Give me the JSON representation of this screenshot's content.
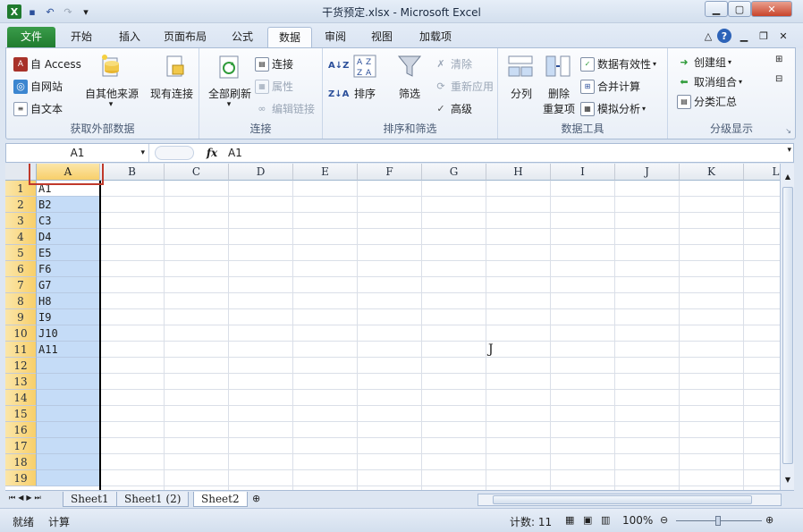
{
  "window": {
    "title": "干货预定.xlsx - Microsoft Excel",
    "minimize_icon": "minimize-icon",
    "maximize_icon": "restore-icon",
    "close_icon": "close-icon"
  },
  "tabs": [
    {
      "label": "文件"
    },
    {
      "label": "开始"
    },
    {
      "label": "插入"
    },
    {
      "label": "页面布局"
    },
    {
      "label": "公式"
    },
    {
      "label": "数据"
    },
    {
      "label": "审阅"
    },
    {
      "label": "视图"
    },
    {
      "label": "加载项"
    }
  ],
  "ribbon": {
    "external": {
      "access": "自 Access",
      "web": "自网站",
      "text": "自文本",
      "other": "自其他来源",
      "existing": "现有连接",
      "label": "获取外部数据"
    },
    "connections": {
      "refresh_all": "全部刷新",
      "connections": "连接",
      "properties": "属性",
      "edit_links": "编辑链接",
      "label": "连接"
    },
    "sort": {
      "sort": "排序",
      "filter": "筛选",
      "clear": "清除",
      "reapply": "重新应用",
      "advanced": "高级",
      "label": "排序和筛选"
    },
    "tools": {
      "split": "分列",
      "remove_dup_1": "删除",
      "remove_dup_2": "重复项",
      "validation": "数据有效性",
      "consolidate": "合并计算",
      "whatif": "模拟分析",
      "label": "数据工具"
    },
    "outline": {
      "group": "创建组",
      "ungroup": "取消组合",
      "subtotal": "分类汇总",
      "label": "分级显示"
    }
  },
  "formula_bar": {
    "name_box": "A1",
    "fx": "fx",
    "value": "A1"
  },
  "grid": {
    "columns": [
      "A",
      "B",
      "C",
      "D",
      "E",
      "F",
      "G",
      "H",
      "I",
      "J",
      "K",
      "L"
    ],
    "rows": [
      "1",
      "2",
      "3",
      "4",
      "5",
      "6",
      "7",
      "8",
      "9",
      "10",
      "11",
      "12",
      "13",
      "14",
      "15",
      "16",
      "17",
      "18",
      "19"
    ],
    "col_a": [
      "A1",
      "B2",
      "C3",
      "D4",
      "E5",
      "F6",
      "G7",
      "H8",
      "I9",
      "J10",
      "A11",
      "",
      "",
      "",
      "",
      "",
      "",
      "",
      ""
    ],
    "cursor_glyph": "J"
  },
  "sheets": [
    {
      "label": "Sheet1"
    },
    {
      "label": "Sheet1 (2)"
    },
    {
      "label": "Sheet2"
    }
  ],
  "status": {
    "ready": "就绪",
    "calc": "计算",
    "count": "计数: 11",
    "zoom": "100%"
  },
  "colors": {
    "file_tab": "#2a8a3a",
    "selection": "#c5dcf7",
    "selected_header": "#f8cf6a",
    "highlight_box": "#c0392b"
  }
}
